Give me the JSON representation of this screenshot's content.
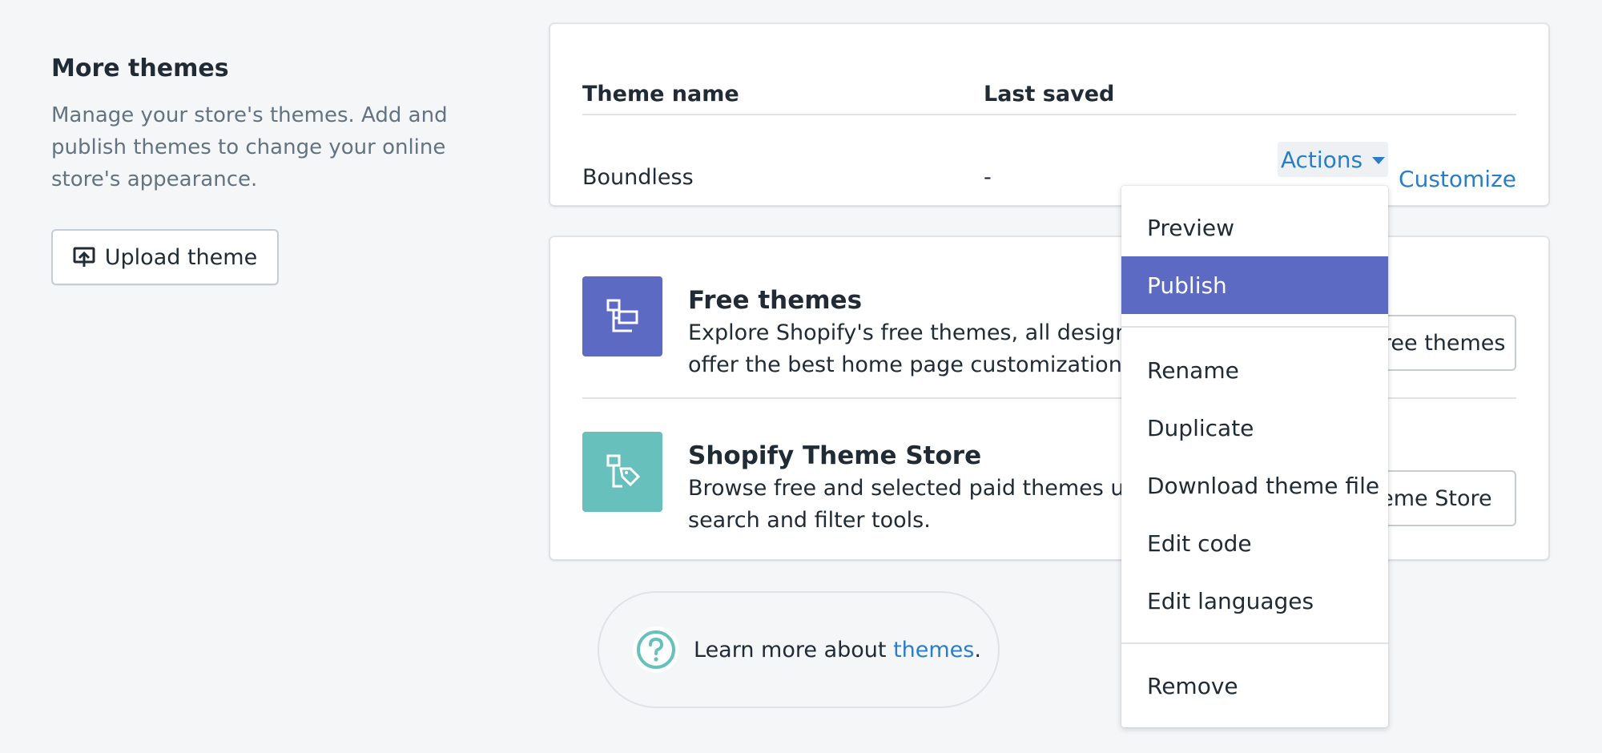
{
  "sidebar": {
    "title": "More themes",
    "description": "Manage your store's themes. Add and publish themes to change your online store's appearance.",
    "upload_label": "Upload theme"
  },
  "theme_table": {
    "col_name": "Theme name",
    "col_saved": "Last saved",
    "rows": [
      {
        "name": "Boundless",
        "saved": "-",
        "actions_label": "Actions",
        "customize_label": "Customize"
      }
    ]
  },
  "free_themes": {
    "title": "Free themes",
    "description": "Explore Shopify's free themes, all designed to offer the best home page customization.",
    "button_label": "Explore free themes"
  },
  "theme_store": {
    "title": "Shopify Theme Store",
    "description": "Browse free and selected paid themes using search and filter tools.",
    "button_label": "Visit Theme Store"
  },
  "learn_more": {
    "prefix": "Learn more about ",
    "link": "themes",
    "suffix": "."
  },
  "actions_menu": {
    "items": [
      "Preview",
      "Publish",
      "Rename",
      "Duplicate",
      "Download theme file",
      "Edit code",
      "Edit languages",
      "Remove"
    ],
    "active": "Publish"
  },
  "colors": {
    "accent": "#5c6ac4",
    "teal": "#68c0bd",
    "link": "#2a7ec8"
  }
}
